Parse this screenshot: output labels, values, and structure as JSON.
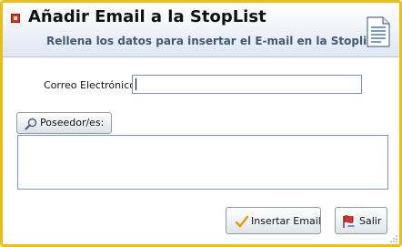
{
  "header": {
    "title": "Añadir Email a la StopList",
    "subtitle": "Rellena los datos para insertar el E-mail en la Stoplist"
  },
  "form": {
    "email_label": "Correo Electrónico:",
    "email_value": "",
    "owners_button_label": "Poseedor/es:",
    "owners_value": ""
  },
  "actions": {
    "insert_label": "Insertar Email",
    "exit_label": "Salir"
  },
  "icons": {
    "app": "app-icon",
    "document": "document-icon",
    "search": "magnifier-icon",
    "check": "checkmark-icon",
    "exit": "flag-exit-icon"
  },
  "colors": {
    "window_border": "#e8bd1c",
    "subtitle": "#415a72",
    "input_border": "#7c96b8"
  }
}
